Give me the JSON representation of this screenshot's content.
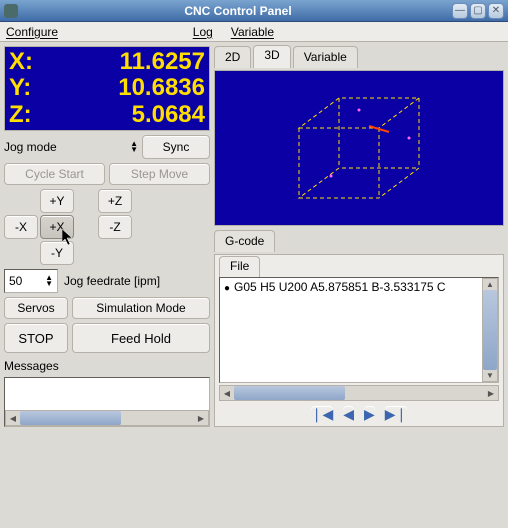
{
  "window": {
    "title": "CNC Control Panel"
  },
  "menu": {
    "configure": "Configure",
    "log": "Log",
    "variable": "Variable"
  },
  "coords": {
    "x_label": "X:",
    "x_value": "11.6257",
    "y_label": "Y:",
    "y_value": "10.6836",
    "z_label": "Z:",
    "z_value": "5.0684"
  },
  "controls": {
    "jogmode": "Jog mode",
    "sync": "Sync",
    "cycle_start": "Cycle Start",
    "step_move": "Step Move",
    "plus_y": "+Y",
    "minus_y": "-Y",
    "plus_x": "+X",
    "minus_x": "-X",
    "plus_z": "+Z",
    "minus_z": "-Z",
    "feed_value": "50",
    "feed_label": "Jog feedrate [ipm]",
    "servos": "Servos",
    "sim_mode": "Simulation Mode",
    "stop": "STOP",
    "feed_hold": "Feed Hold"
  },
  "messages": {
    "label": "Messages"
  },
  "tabs3d": {
    "t2d": "2D",
    "t3d": "3D",
    "tvar": "Variable"
  },
  "gcode": {
    "tab1": "G-code",
    "tab2": "File",
    "line": "G05 H5 U200 A5.875851 B-3.533175 C"
  },
  "nav": {
    "first": "⏮",
    "back": "◀",
    "next": "▶",
    "last": "⏭"
  }
}
